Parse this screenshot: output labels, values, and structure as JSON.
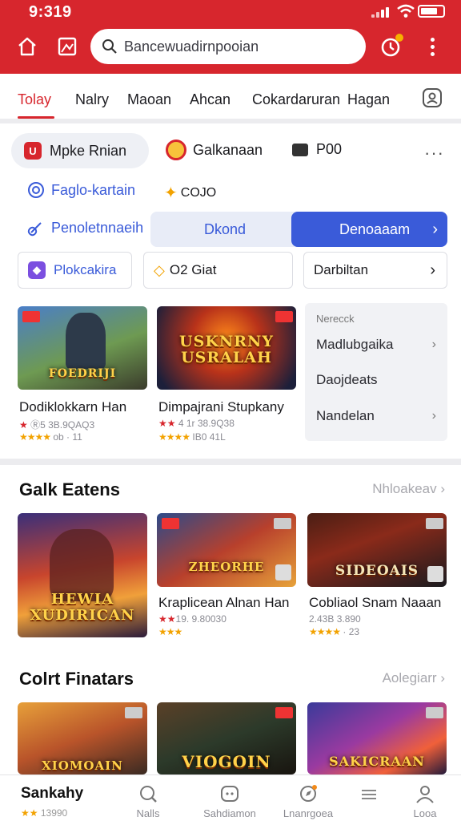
{
  "status_bar": {
    "time": "9:319"
  },
  "search": {
    "placeholder": "Bancewuadirnpooian"
  },
  "tabs": [
    {
      "label": "Tolay",
      "active": true
    },
    {
      "label": "Nalry"
    },
    {
      "label": "Maoan"
    },
    {
      "label": "Ahcan"
    },
    {
      "label": "Cokardaruran"
    },
    {
      "label": "Hagan"
    }
  ],
  "quick": {
    "pill_label": "Mpke Rnian",
    "chip2": "Galkanaan",
    "chip3": "P00",
    "link1": "Faglo-kartain",
    "coin_label": "COJO",
    "link2": "Penoletnnaeih",
    "segment_left": "Dkond",
    "segment_right": "Denoaaam",
    "btn1": "Plokcakira",
    "btn2": "O2 Giat",
    "btn3": "Darbiltan"
  },
  "featured": [
    {
      "art_text": "FOEDRIJI",
      "title": "Dodiklokkarn Han",
      "rating": "Ⓡ5 3B.9QAQ3",
      "sub": "ob · 11"
    },
    {
      "art_text": "USKNRNY USRALAH",
      "title": "Dimpajrani Stupkany",
      "rating": "4 1r 38.9Q38",
      "sub": "IB0 41L"
    }
  ],
  "side_panel": {
    "header": "Nerecck",
    "items": [
      "Madlubgaika",
      "Daojdeats",
      "Nandelan"
    ]
  },
  "section1": {
    "title": "Galk Eatens",
    "more": "Nhloakeav",
    "cards": [
      {
        "art_text": "HEWIA XUDIRICAN",
        "title": "",
        "rating": ""
      },
      {
        "art_text": "ZHEORHE",
        "title": "Kraplicean Alnan Han",
        "rating": "19. 9.80030",
        "sub": ""
      },
      {
        "art_text": "SIDEOAIS",
        "title": "Cobliaol Snam Naaan",
        "rating": "2.43B 3.890",
        "sub": "· 23"
      }
    ]
  },
  "section2": {
    "title": "Colrt Finatars",
    "more": "Aolegiarr"
  },
  "section2_cards": [
    {
      "art_text": "XIOMOAIN"
    },
    {
      "art_text": "VIOGOIN"
    },
    {
      "art_text": "SAKICRAAN"
    }
  ],
  "bottom_partial": {
    "title": "Sankahy",
    "rating": "13990"
  },
  "bottom_nav": [
    {
      "label": "Nalls",
      "icon": "search-icon"
    },
    {
      "label": "Sahdiamon",
      "icon": "game-icon"
    },
    {
      "label": "Lnanrgoea",
      "icon": "compass-icon"
    },
    {
      "label": "",
      "icon": "menu-icon"
    },
    {
      "label": "Looa",
      "icon": "user-icon"
    }
  ],
  "colors": {
    "brand_red": "#d7262d",
    "accent_blue": "#3a5bd9",
    "star": "#f2a200"
  }
}
